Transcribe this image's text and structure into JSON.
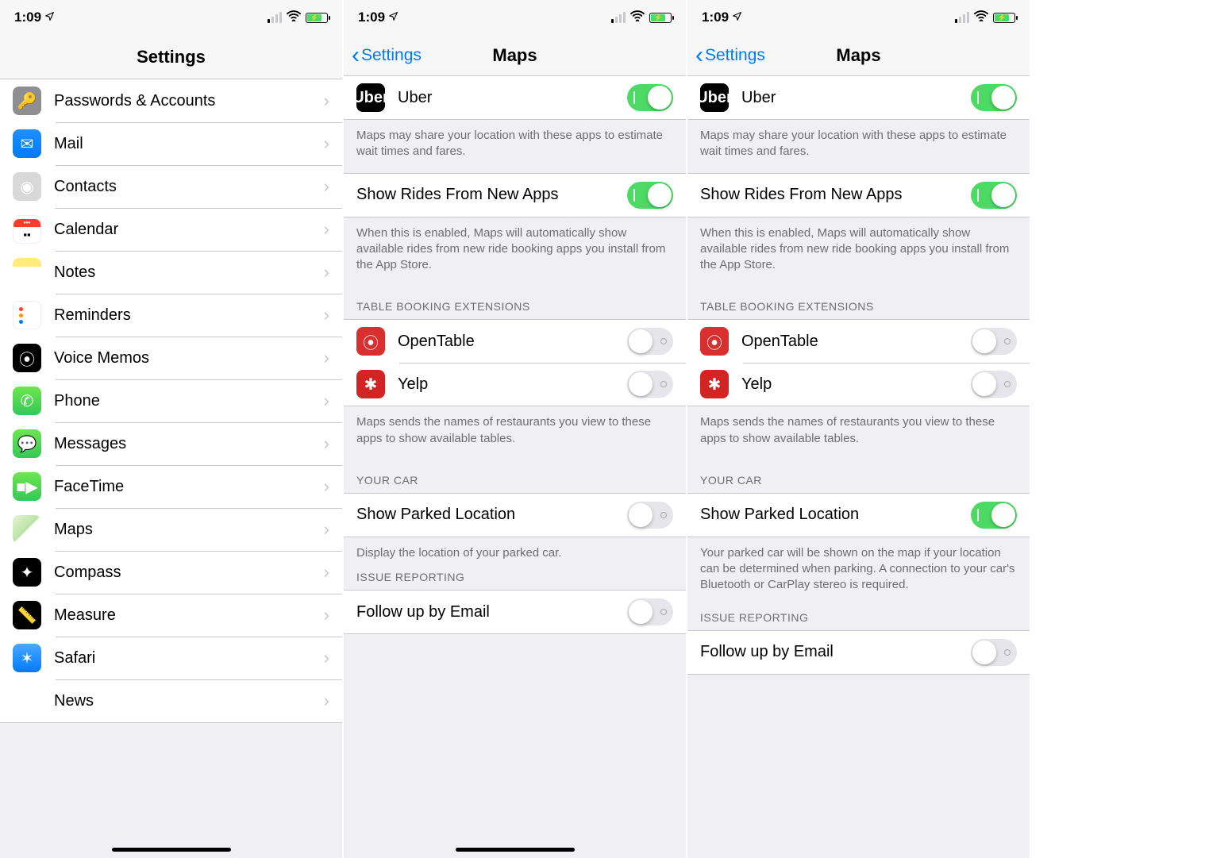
{
  "status": {
    "time": "1:09"
  },
  "screen1": {
    "title": "Settings",
    "items": [
      {
        "id": "passwords",
        "label": "Passwords & Accounts"
      },
      {
        "id": "mail",
        "label": "Mail"
      },
      {
        "id": "contacts",
        "label": "Contacts"
      },
      {
        "id": "calendar",
        "label": "Calendar"
      },
      {
        "id": "notes",
        "label": "Notes"
      },
      {
        "id": "reminders",
        "label": "Reminders"
      },
      {
        "id": "voicememos",
        "label": "Voice Memos"
      },
      {
        "id": "phone",
        "label": "Phone"
      },
      {
        "id": "messages",
        "label": "Messages"
      },
      {
        "id": "facetime",
        "label": "FaceTime"
      },
      {
        "id": "maps",
        "label": "Maps"
      },
      {
        "id": "compass",
        "label": "Compass"
      },
      {
        "id": "measure",
        "label": "Measure"
      },
      {
        "id": "safari",
        "label": "Safari"
      },
      {
        "id": "news",
        "label": "News"
      }
    ]
  },
  "screen2": {
    "back": "Settings",
    "title": "Maps",
    "uber": "Uber",
    "rideFooter": "Maps may share your location with these apps to estimate wait times and fares.",
    "showRides": "Show Rides From New Apps",
    "showRidesFooter": "When this is enabled, Maps will automatically show available rides from new ride booking apps you install from the App Store.",
    "tableHeader": "TABLE BOOKING EXTENSIONS",
    "opentable": "OpenTable",
    "yelp": "Yelp",
    "tableFooter": "Maps sends the names of restaurants you view to these apps to show available tables.",
    "carHeader": "YOUR CAR",
    "parked": "Show Parked Location",
    "parkedFooter": "Display the location of your parked car.",
    "issueHeader": "ISSUE REPORTING",
    "followup": "Follow up by Email",
    "toggles": {
      "uber": true,
      "showRides": true,
      "opentable": false,
      "yelp": false,
      "parked": false,
      "followup": false
    }
  },
  "screen3": {
    "back": "Settings",
    "title": "Maps",
    "uber": "Uber",
    "rideFooter": "Maps may share your location with these apps to estimate wait times and fares.",
    "showRides": "Show Rides From New Apps",
    "showRidesFooter": "When this is enabled, Maps will automatically show available rides from new ride booking apps you install from the App Store.",
    "tableHeader": "TABLE BOOKING EXTENSIONS",
    "opentable": "OpenTable",
    "yelp": "Yelp",
    "tableFooter": "Maps sends the names of restaurants you view to these apps to show available tables.",
    "carHeader": "YOUR CAR",
    "parked": "Show Parked Location",
    "parkedFooter": "Your parked car will be shown on the map if your location can be determined when parking. A connection to your car's Bluetooth or CarPlay stereo is required.",
    "issueHeader": "ISSUE REPORTING",
    "followup": "Follow up by Email",
    "toggles": {
      "uber": true,
      "showRides": true,
      "opentable": false,
      "yelp": false,
      "parked": true,
      "followup": false
    }
  }
}
